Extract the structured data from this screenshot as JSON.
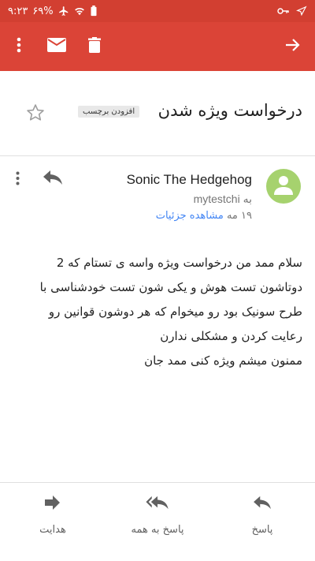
{
  "status_bar": {
    "time": "۹:۲۳",
    "battery": "۶۹%"
  },
  "toolbar": {
    "icons": [
      "more-vert-icon",
      "mail-icon",
      "trash-icon",
      "forward-arrow-icon"
    ]
  },
  "email": {
    "subject": "درخواست ویژه شدن",
    "label_chip": "افزودن برچسب",
    "sender_name": "Sonic The Hedgehog",
    "recipient_prefix": "به",
    "recipient": "mytestchi",
    "date": "۱۹ مه",
    "details_link": "مشاهده جزئیات",
    "body_lines": [
      "سلام ممد من درخواست ویژه واسه ی تستام که 2",
      "دوتاشون تست هوش و یکی شون تست خودشناسی با",
      "طرح سونیک بود رو میخوام که هر دوشون قوانین رو",
      "رعایت کردن و مشکلی ندارن",
      "ممنون میشم ویژه کنی ممد جان"
    ]
  },
  "actions": {
    "reply": "پاسخ",
    "reply_all": "پاسخ به همه",
    "forward": "هدایت"
  },
  "colors": {
    "toolbar": "#db4437",
    "status_bar": "#d23f31",
    "avatar": "#a6d26e",
    "link": "#4285f4"
  }
}
